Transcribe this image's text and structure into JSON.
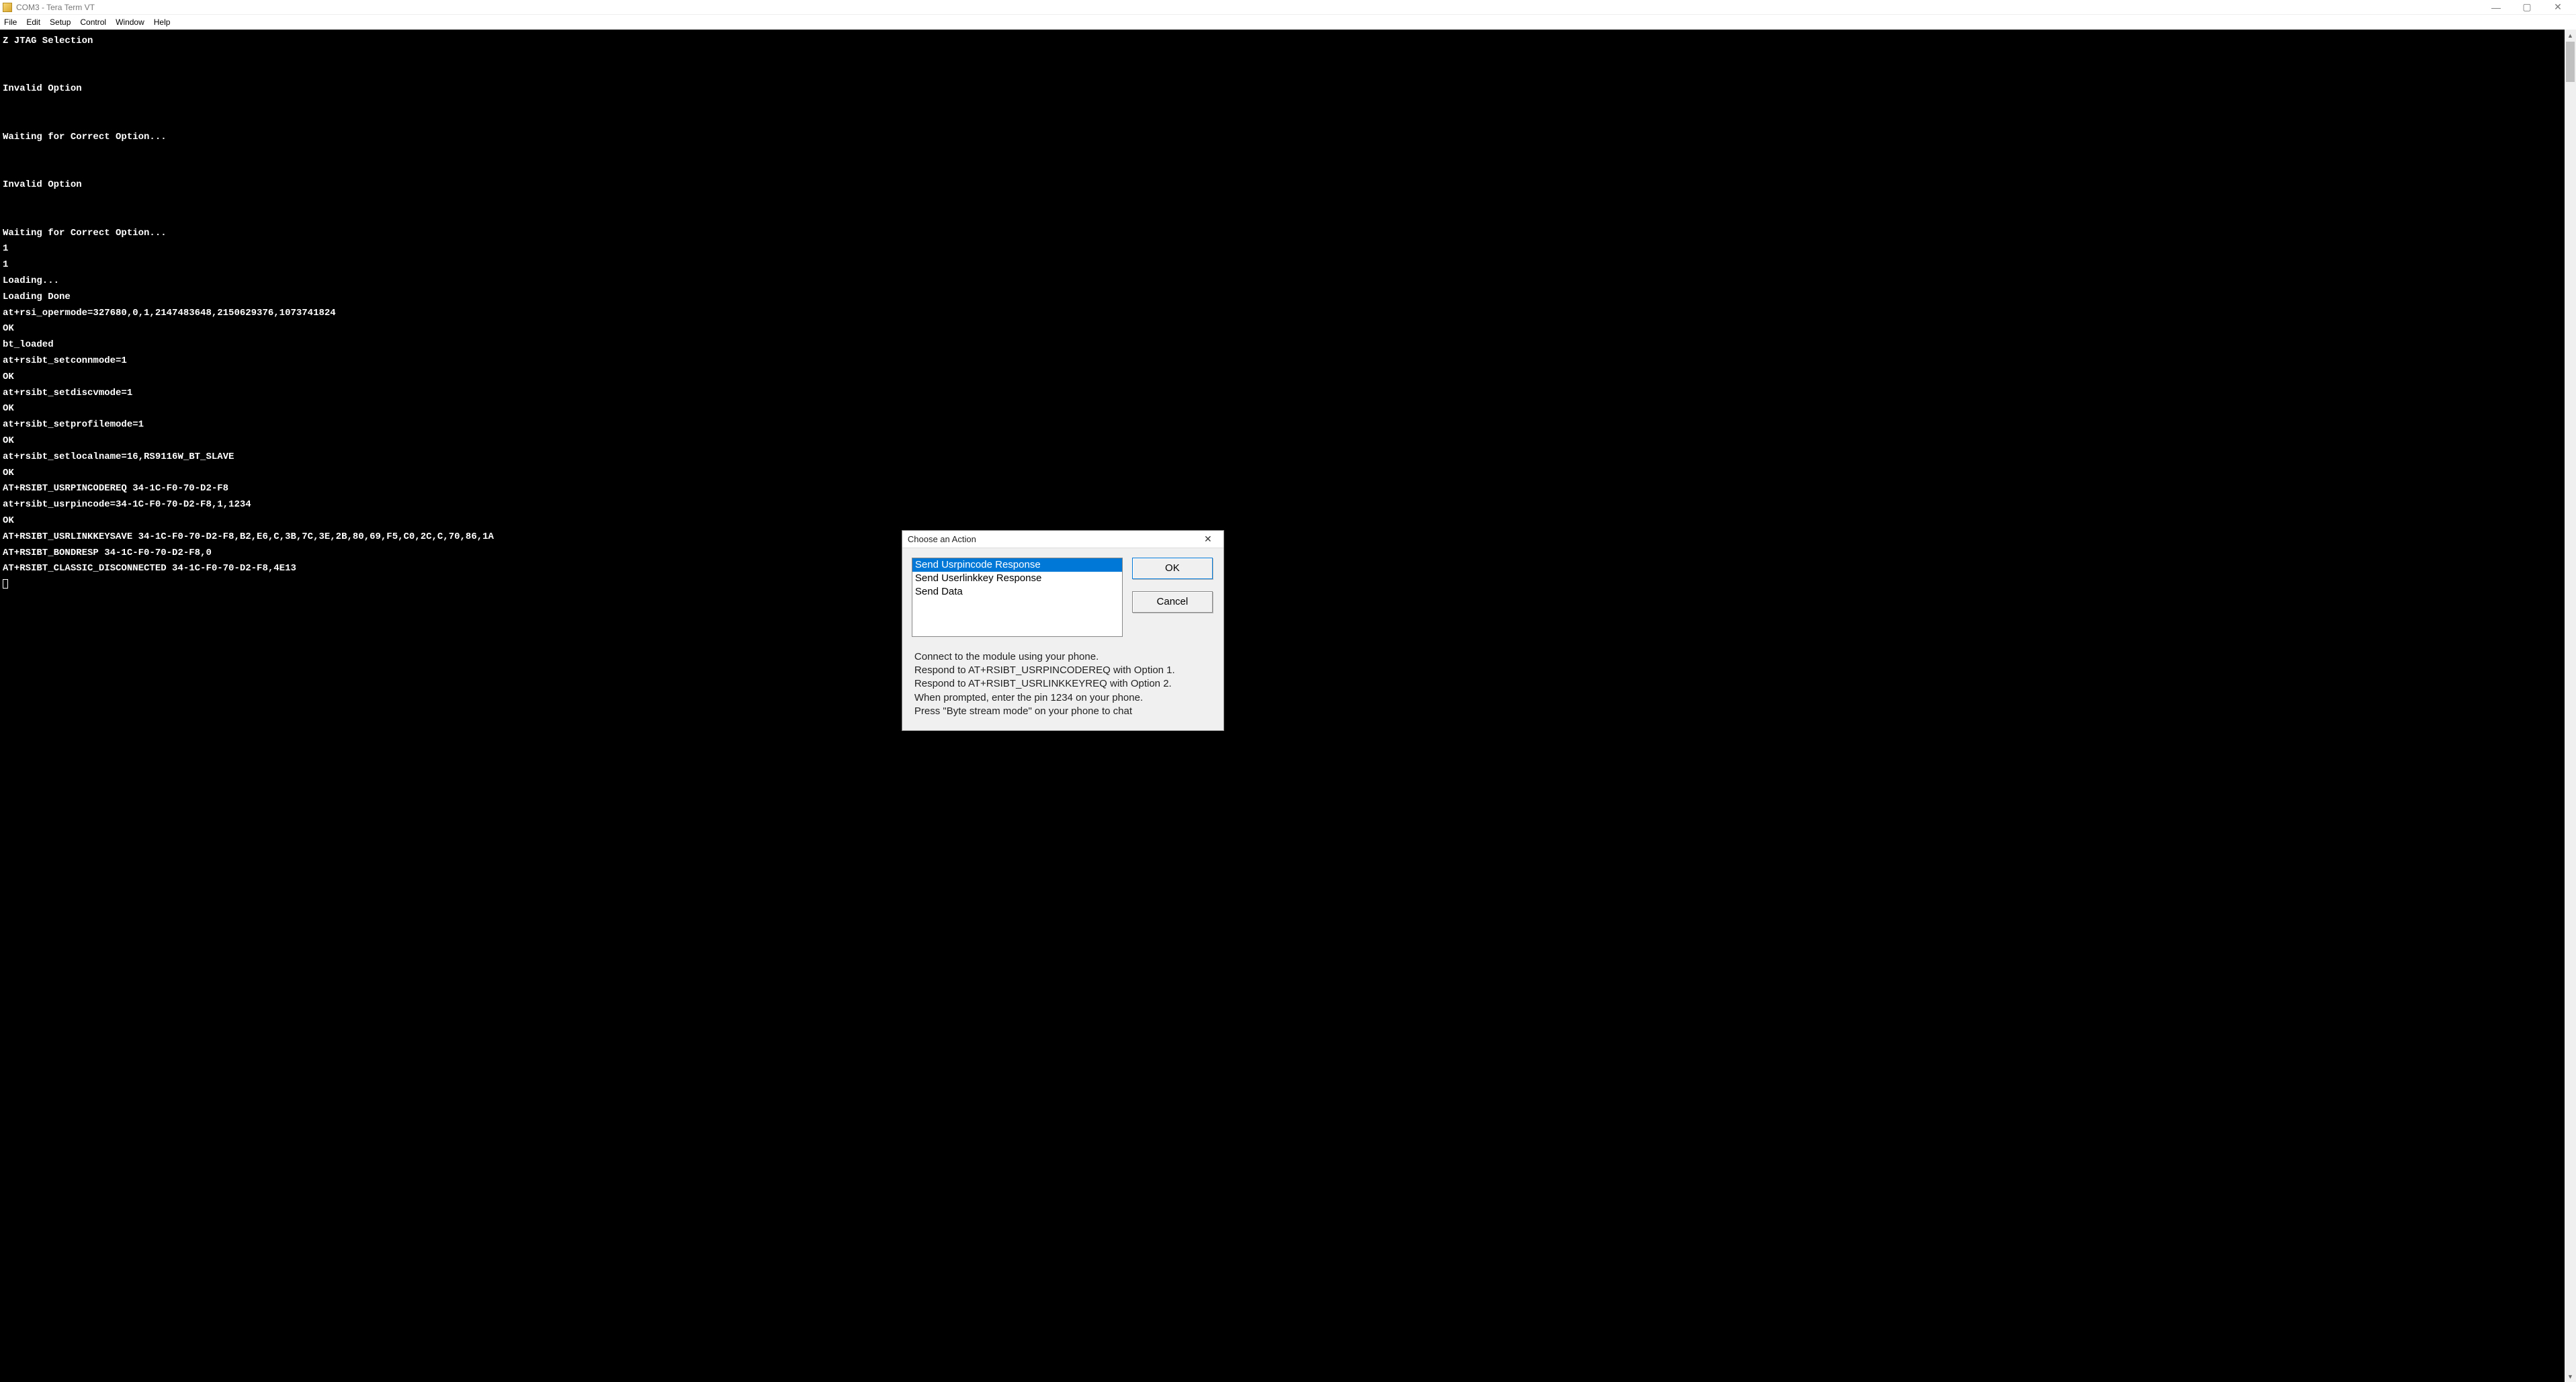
{
  "window": {
    "title": "COM3 - Tera Term VT"
  },
  "menubar": {
    "items": [
      "File",
      "Edit",
      "Setup",
      "Control",
      "Window",
      "Help"
    ]
  },
  "terminal": {
    "lines": [
      "Z JTAG Selection",
      "",
      "",
      "Invalid Option",
      "",
      "",
      "Waiting for Correct Option...",
      "",
      "",
      "Invalid Option",
      "",
      "",
      "Waiting for Correct Option...",
      "1",
      "1",
      "Loading...",
      "Loading Done",
      "at+rsi_opermode=327680,0,1,2147483648,2150629376,1073741824",
      "OK",
      "bt_loaded",
      "at+rsibt_setconnmode=1",
      "OK",
      "at+rsibt_setdiscvmode=1",
      "OK",
      "at+rsibt_setprofilemode=1",
      "OK",
      "at+rsibt_setlocalname=16,RS9116W_BT_SLAVE",
      "OK",
      "AT+RSIBT_USRPINCODEREQ 34-1C-F0-70-D2-F8",
      "at+rsibt_usrpincode=34-1C-F0-70-D2-F8,1,1234",
      "OK",
      "AT+RSIBT_USRLINKKEYSAVE 34-1C-F0-70-D2-F8,B2,E6,C,3B,7C,3E,2B,80,69,F5,C0,2C,C,70,86,1A",
      "AT+RSIBT_BONDRESP 34-1C-F0-70-D2-F8,0",
      "AT+RSIBT_CLASSIC_DISCONNECTED 34-1C-F0-70-D2-F8,4E13"
    ]
  },
  "dialog": {
    "title": "Choose an Action",
    "options": [
      "Send Usrpincode Response",
      "Send Userlinkkey Response",
      "Send Data"
    ],
    "selected_index": 0,
    "buttons": {
      "ok": "OK",
      "cancel": "Cancel"
    },
    "instructions": [
      "Connect to the module using your phone.",
      "Respond to AT+RSIBT_USRPINCODEREQ with Option 1.",
      "Respond to AT+RSIBT_USRLINKKEYREQ with Option 2.",
      "When prompted, enter the pin 1234 on your phone.",
      "Press \"Byte stream mode\" on your phone to chat"
    ]
  }
}
